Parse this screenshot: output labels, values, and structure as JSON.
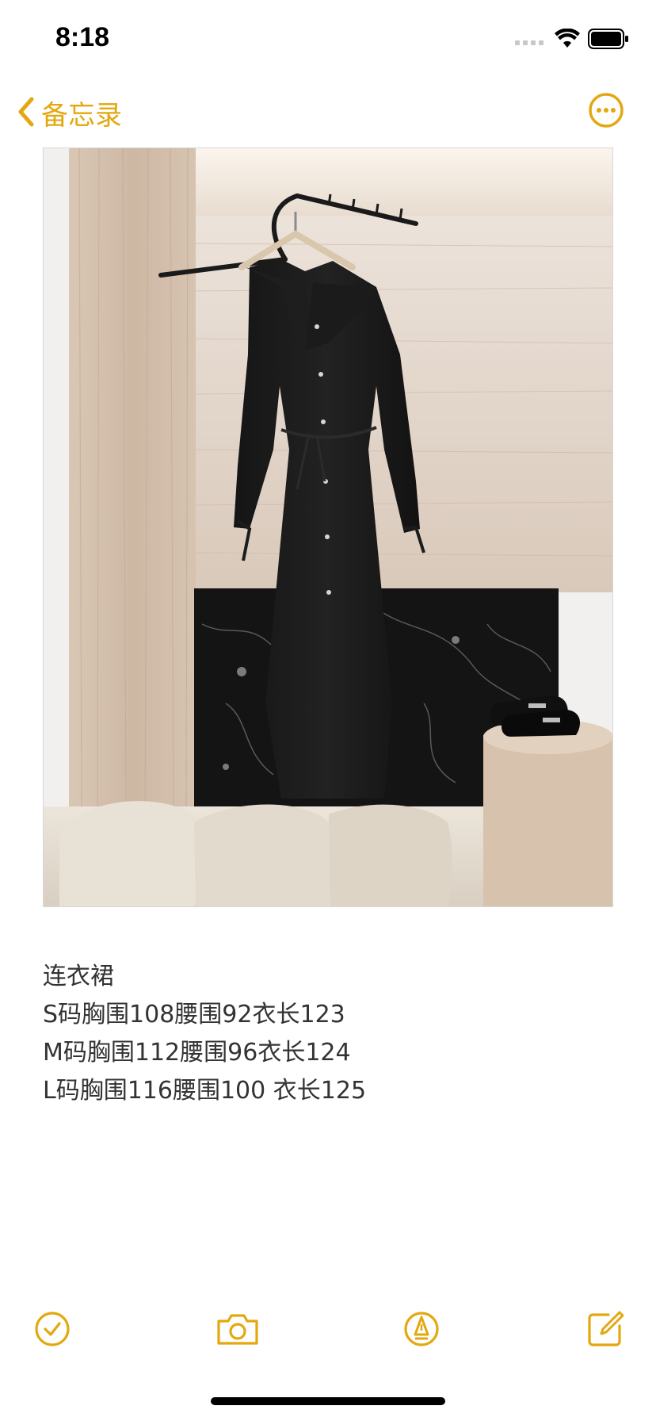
{
  "status_bar": {
    "time": "8:18"
  },
  "nav": {
    "back_label": "备忘录",
    "back_icon": "chevron-left-icon",
    "more_icon": "ellipsis-circle-icon"
  },
  "photo": {
    "description_icon": "dress-photo"
  },
  "note": {
    "lines": [
      "连衣裙",
      "S码胸围108腰围92衣长123",
      "M码胸围112腰围96衣长124",
      "L码胸围116腰围100 衣长125"
    ]
  },
  "toolbar": {
    "checklist_icon": "checkmark-circle-icon",
    "camera_icon": "camera-icon",
    "markup_icon": "pen-tip-circle-icon",
    "compose_icon": "compose-icon"
  },
  "colors": {
    "accent": "#e3a80f",
    "text": "#333333"
  }
}
